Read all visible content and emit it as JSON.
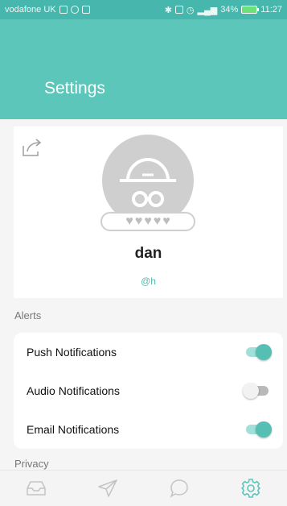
{
  "status_bar": {
    "carrier": "vodafone UK",
    "battery": "34%",
    "time": "11:27"
  },
  "header": {
    "title": "Settings"
  },
  "profile": {
    "name": "dan",
    "handle": "@h",
    "hearts": [
      "♥",
      "♥",
      "♥",
      "♥",
      "♥"
    ],
    "avatar_icon": "incognito-hat-glasses-icon",
    "share_icon": "share-icon"
  },
  "alerts": {
    "section_label": "Alerts",
    "items": [
      {
        "label": "Push Notifications",
        "enabled": true
      },
      {
        "label": "Audio Notifications",
        "enabled": false
      },
      {
        "label": "Email Notifications",
        "enabled": true
      }
    ]
  },
  "privacy": {
    "section_label": "Privacy"
  },
  "tabbar": {
    "items": [
      {
        "icon": "inbox-icon",
        "active": false
      },
      {
        "icon": "send-icon",
        "active": false
      },
      {
        "icon": "chat-icon",
        "active": false
      },
      {
        "icon": "gear-icon",
        "active": true
      }
    ]
  },
  "colors": {
    "accent": "#5cc6bb",
    "status_bar": "#47b7ad",
    "inactive_icon": "#c4c4c4"
  }
}
